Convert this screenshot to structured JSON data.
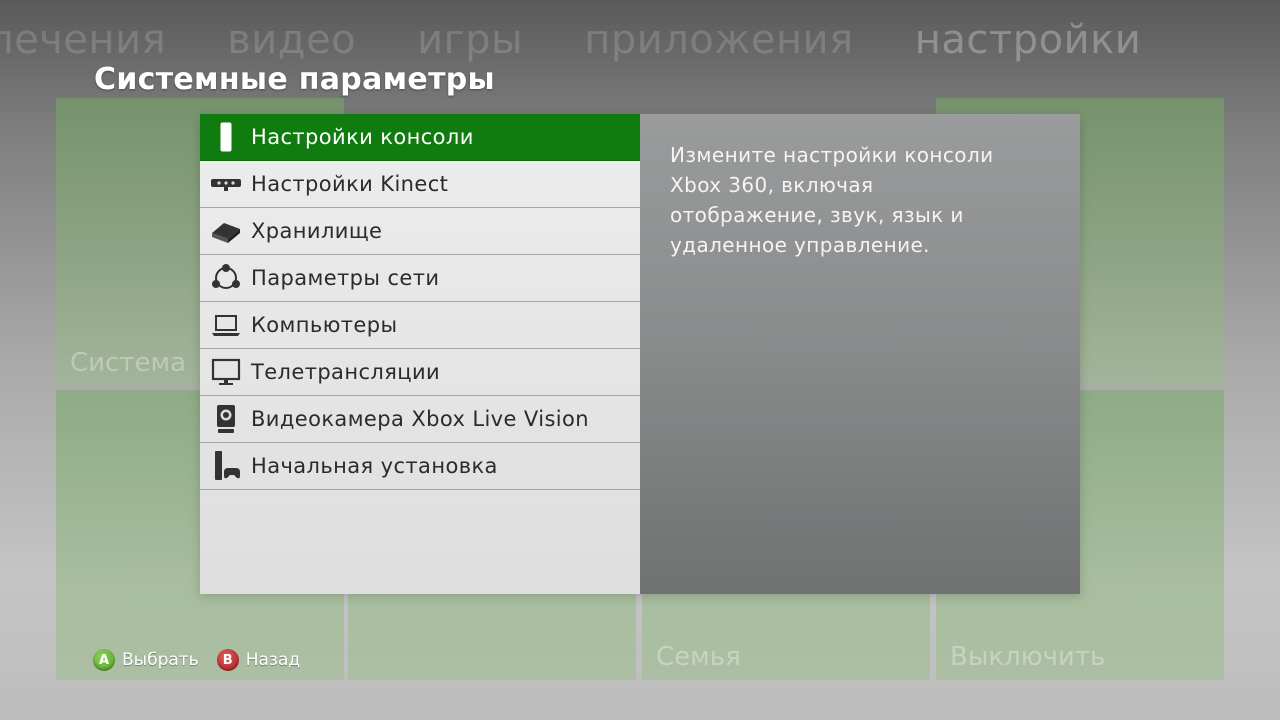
{
  "background": {
    "pivots": [
      "лечения",
      "видео",
      "игры",
      "приложения",
      "настройки"
    ],
    "active_pivot_index": 4,
    "tiles": [
      "Система",
      "Семья",
      "Выключить"
    ]
  },
  "page_title": "Системные параметры",
  "menu": {
    "selected_index": 0,
    "items": [
      {
        "label": "Настройки консоли",
        "icon": "console-icon"
      },
      {
        "label": "Настройки Kinect",
        "icon": "kinect-icon"
      },
      {
        "label": "Хранилище",
        "icon": "storage-icon"
      },
      {
        "label": "Параметры сети",
        "icon": "network-icon"
      },
      {
        "label": "Компьютеры",
        "icon": "laptop-icon"
      },
      {
        "label": "Телетрансляции",
        "icon": "monitor-icon"
      },
      {
        "label": "Видеокамера Xbox Live Vision",
        "icon": "camera-icon"
      },
      {
        "label": "Начальная установка",
        "icon": "setup-icon"
      }
    ]
  },
  "description": "Измените настройки консоли Xbox 360, включая отображение, звук, язык и удаленное управление.",
  "footer": {
    "select": {
      "button": "A",
      "label": "Выбрать"
    },
    "back": {
      "button": "B",
      "label": "Назад"
    }
  },
  "colors": {
    "accent_green": "#107c10",
    "button_a": "#5fae2c",
    "button_b": "#c02a2a"
  }
}
